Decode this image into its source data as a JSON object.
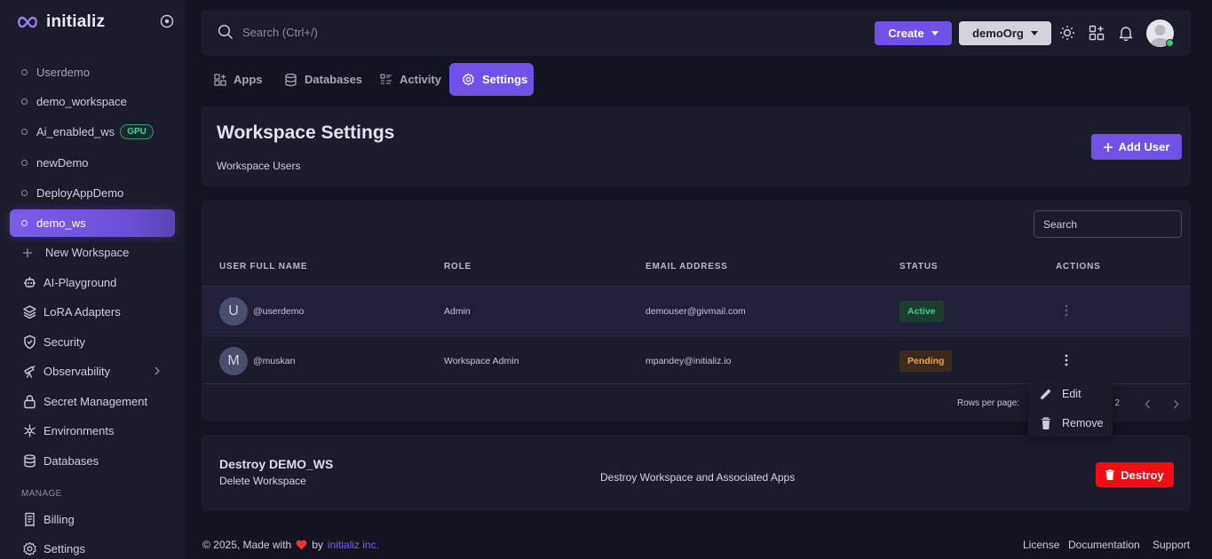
{
  "brand": {
    "name": "initializ"
  },
  "sidebar": {
    "workspaces": [
      {
        "label": "Userdemo"
      },
      {
        "label": "demo_workspace"
      },
      {
        "label": "Ai_enabled_ws",
        "badge": "GPU"
      },
      {
        "label": "newDemo"
      },
      {
        "label": "DeployAppDemo"
      },
      {
        "label": "demo_ws",
        "active": true
      }
    ],
    "new_workspace": "New Workspace",
    "items": [
      {
        "label": "AI-Playground",
        "icon": "ai-playground-icon"
      },
      {
        "label": "LoRA Adapters",
        "icon": "layers-icon"
      },
      {
        "label": "Security",
        "icon": "shield-icon"
      },
      {
        "label": "Observability",
        "icon": "telescope-icon"
      },
      {
        "label": "Secret Management",
        "icon": "lock-icon"
      },
      {
        "label": "Environments",
        "icon": "snowflake-icon"
      },
      {
        "label": "Databases",
        "icon": "database-icon"
      }
    ],
    "section_manage": "MANAGE",
    "manage_items": [
      {
        "label": "Billing",
        "icon": "receipt-icon"
      },
      {
        "label": "Settings",
        "icon": "gear-icon"
      }
    ]
  },
  "topbar": {
    "search_placeholder": "Search (Ctrl+/)",
    "create_label": "Create",
    "org_label": "demoOrg"
  },
  "tabs": [
    {
      "label": "Apps"
    },
    {
      "label": "Databases"
    },
    {
      "label": "Activity"
    },
    {
      "label": "Settings",
      "active": true
    }
  ],
  "header": {
    "title": "Workspace Settings",
    "subtitle": "Workspace Users",
    "add_user_label": "Add User"
  },
  "table": {
    "search_placeholder": "Search",
    "columns": [
      "USER FULL NAME",
      "ROLE",
      "EMAIL ADDRESS",
      "STATUS",
      "ACTIONS"
    ],
    "rows": [
      {
        "initial": "U",
        "username": "@userdemo",
        "role": "Admin",
        "email": "demouser@givmail.com",
        "status": "Active"
      },
      {
        "initial": "M",
        "username": "@muskan",
        "role": "Workspace Admin",
        "email": "mpandey@initializ.io",
        "status": "Pending"
      }
    ],
    "rows_per_page_label": "Rows per page:",
    "page_info": "f 2"
  },
  "row_menu": {
    "edit": "Edit",
    "remove": "Remove"
  },
  "destroy": {
    "title": "Destroy DEMO_WS",
    "subtitle": "Delete Workspace",
    "description": "Destroy Workspace and Associated Apps",
    "button": "Destroy"
  },
  "footer": {
    "copyright": "© 2025, Made with",
    "by": "by",
    "company": "initializ inc.",
    "links": [
      "License",
      "Documentation",
      "Support"
    ]
  },
  "colors": {
    "accent": "#7152e6",
    "danger": "#f10d14",
    "active_status": "#3ecf84",
    "pending_status": "#f0a04a"
  }
}
